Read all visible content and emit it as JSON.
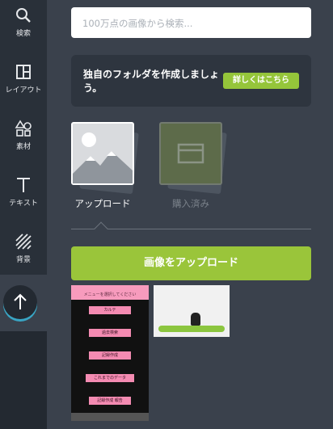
{
  "sidebar": {
    "items": [
      {
        "label": "検索",
        "icon": "search-icon"
      },
      {
        "label": "レイアウト",
        "icon": "layout-icon"
      },
      {
        "label": "素材",
        "icon": "shapes-icon"
      },
      {
        "label": "テキスト",
        "icon": "text-icon"
      },
      {
        "label": "背景",
        "icon": "background-icon"
      }
    ],
    "active": "upload-icon"
  },
  "search": {
    "placeholder": "100万点の画像から検索..."
  },
  "promo": {
    "text": "独自のフォルダを作成しましょう。",
    "button": "詳しくはこちら"
  },
  "tabs": [
    {
      "label": "アップロード",
      "active": true
    },
    {
      "label": "購入済み",
      "active": false
    }
  ],
  "upload_button": "画像をアップロード",
  "thumbnails": {
    "phone": {
      "header": "メニューを選択してください",
      "items": [
        "カルテ",
        "過去検索",
        "記録作成",
        "これまでのデータ",
        "記録作成 報告"
      ]
    }
  },
  "colors": {
    "accent_green": "#9ac53a",
    "sidebar_bg": "#293039",
    "panel_bg": "#3a414c",
    "upload_ring": "#39a5c4"
  }
}
